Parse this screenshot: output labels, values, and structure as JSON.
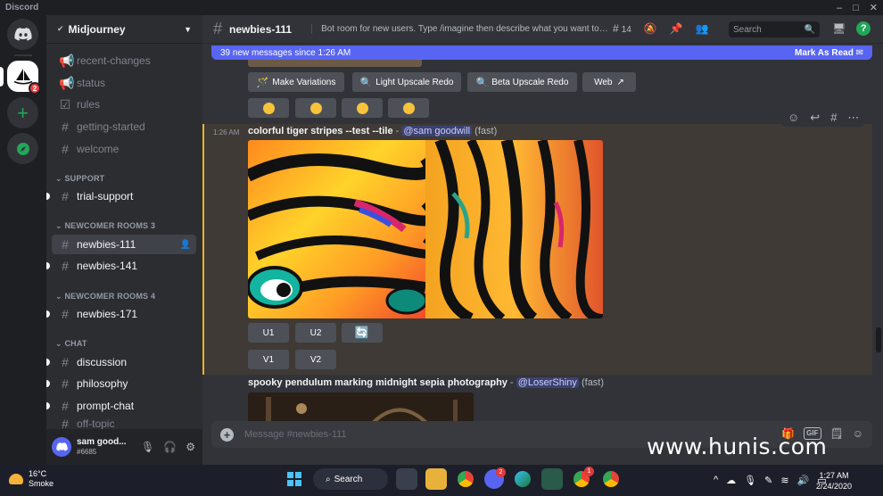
{
  "window": {
    "app_name": "Discord",
    "controls": [
      "–",
      "□",
      "✕"
    ]
  },
  "rail": {
    "home_badge": "",
    "mj_badge": "2"
  },
  "guild": {
    "name": "Midjourney"
  },
  "channels": {
    "top": [
      {
        "label": "recent-changes",
        "icon": "megaphone-icon"
      },
      {
        "label": "status",
        "icon": "megaphone-icon"
      },
      {
        "label": "rules",
        "icon": "checkbox-icon"
      },
      {
        "label": "getting-started",
        "icon": "hash-icon"
      },
      {
        "label": "welcome",
        "icon": "hash-icon"
      }
    ],
    "cat_support": "SUPPORT",
    "trial_support": "trial-support",
    "cat_newcomer3": "NEWCOMER ROOMS 3",
    "newbies111": "newbies-111",
    "newbies141": "newbies-141",
    "cat_newcomer4": "NEWCOMER ROOMS 4",
    "newbies171": "newbies-171",
    "cat_chat": "CHAT",
    "discussion": "discussion",
    "philosophy": "philosophy",
    "prompt_chat": "prompt-chat",
    "off_topic": "off-topic"
  },
  "user": {
    "name": "sam good...",
    "tag": "#6685"
  },
  "header": {
    "channel": "newbies-111",
    "topic": "Bot room for new users. Type /imagine then describe what you want to dra...",
    "threads_count": "14",
    "search_placeholder": "Search"
  },
  "new_messages": {
    "text": "39 new messages since 1:26 AM",
    "mark_read": "Mark As Read"
  },
  "action_buttons": {
    "make_variations": "Make Variations",
    "light_upscale": "Light Upscale Redo",
    "beta_upscale": "Beta Upscale Redo",
    "web": "Web"
  },
  "message1": {
    "time": "1:26 AM",
    "prompt": "colorful tiger stripes --test --tile",
    "dash": " - ",
    "mention": "@sam goodwill",
    "speed": "(fast)",
    "buttons": {
      "u1": "U1",
      "u2": "U2",
      "v1": "V1",
      "v2": "V2"
    }
  },
  "message2": {
    "prompt": "spooky pendulum marking midnight sepia photography",
    "dash": " - ",
    "mention": "@LoserShiny",
    "speed": "(fast)"
  },
  "composer": {
    "placeholder": "Message #newbies-111"
  },
  "watermark": "www.hunis.com",
  "taskbar": {
    "temp": "16°C",
    "condition": "Smoke",
    "search": "Search",
    "discord_badge": "2",
    "chrome_badge": "1",
    "time": "1:27 AM",
    "date": "2/24/2020"
  },
  "colors": {
    "accent": "#5865f2",
    "highlight_border": "#f0b232",
    "online": "#23a55a"
  }
}
